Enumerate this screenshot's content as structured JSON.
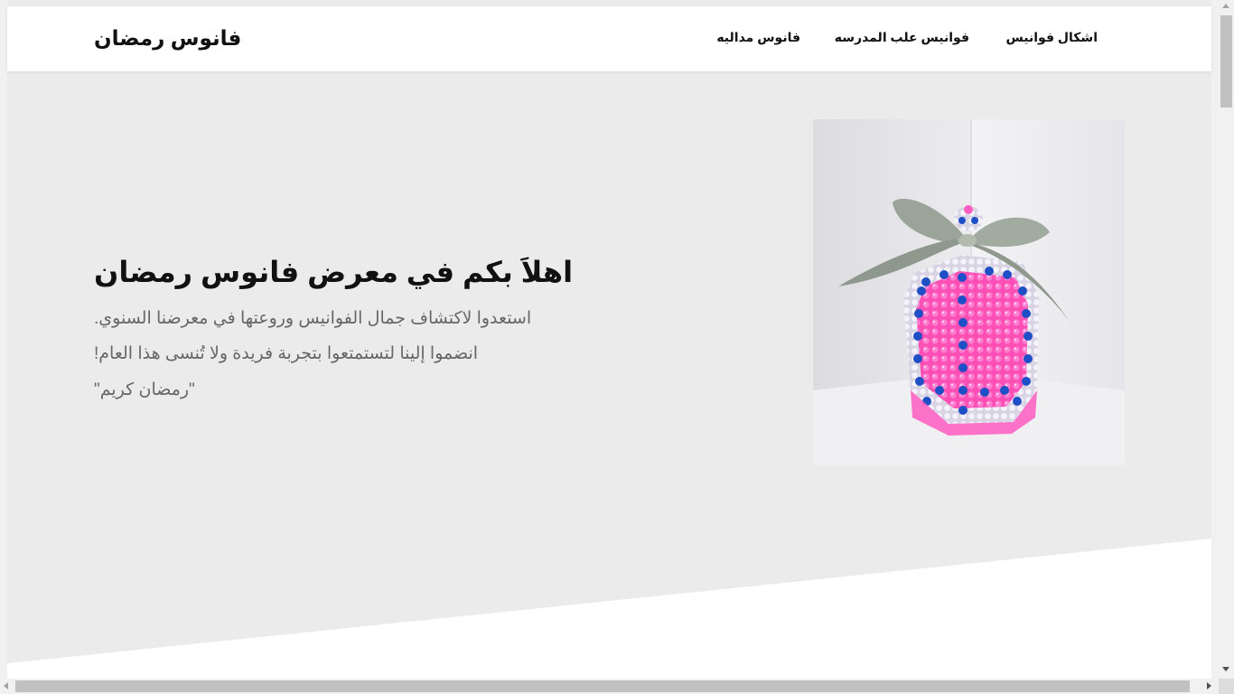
{
  "navbar": {
    "brand": "فانوس رمضان",
    "links": [
      {
        "label": "اشكال فوانيس"
      },
      {
        "label": "فوانيس علب المدرسه"
      },
      {
        "label": "فانوس مداليه"
      }
    ]
  },
  "hero": {
    "title": "اهلاَ بكم في معرض فانوس رمضان",
    "lines": [
      "استعدوا لاكتشاف جمال الفوانيس وروعتها في معرضنا السنوي.",
      "انضموا إلينا لتستمتعوا بتجربة فريدة ولا تُنسى هذا العام!",
      "\"رمضان كريم\""
    ]
  },
  "colors": {
    "hero_background": "#ebebeb",
    "page_background": "#ffffff",
    "text_primary": "#111111",
    "text_muted": "#666666"
  },
  "icons": {
    "vertical_scrollbar": "scrollbar",
    "horizontal_scrollbar": "scrollbar"
  }
}
